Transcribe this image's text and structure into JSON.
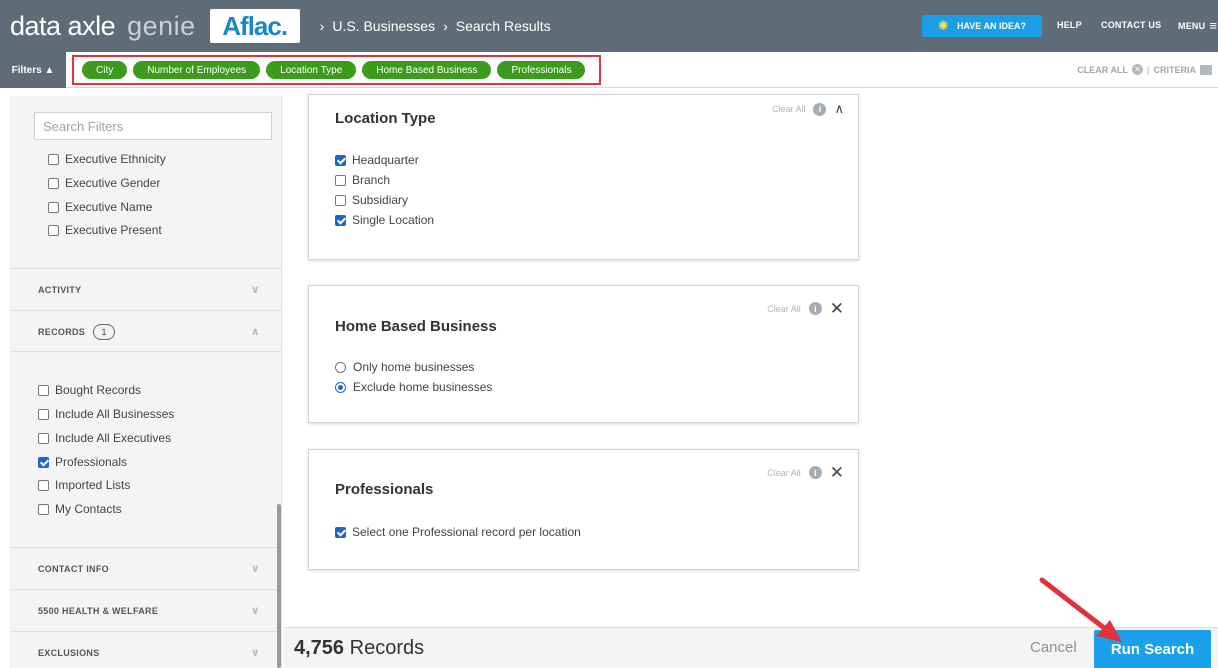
{
  "header": {
    "brand_name": "data axle",
    "brand_product": "genie",
    "client_logo_text": "Aflac.",
    "breadcrumb": [
      "U.S. Businesses",
      "Search Results"
    ],
    "breadcrumb_separator": "›",
    "idea_button": "HAVE AN IDEA?",
    "help": "HELP",
    "contact": "CONTACT US",
    "menu": "MENU"
  },
  "filter_bar": {
    "toggle_label": "Filters ▲",
    "chips": [
      "City",
      "Number of Employees",
      "Location Type",
      "Home Based Business",
      "Professionals"
    ],
    "clear_all": "CLEAR ALL",
    "criteria": "CRITERIA",
    "chip_color": "#3c9a1c",
    "highlight_color": "#e0323a"
  },
  "sidebar": {
    "search_placeholder": "Search Filters",
    "executive_items": [
      {
        "label": "Executive Ethnicity",
        "checked": false
      },
      {
        "label": "Executive Gender",
        "checked": false
      },
      {
        "label": "Executive Name",
        "checked": false
      },
      {
        "label": "Executive Present",
        "checked": false
      }
    ],
    "sections": {
      "activity": "ACTIVITY",
      "records": "RECORDS",
      "records_count": "1",
      "contact_info": "CONTACT INFO",
      "health_welfare": "5500 HEALTH & WELFARE",
      "exclusions": "EXCLUSIONS"
    },
    "record_items": [
      {
        "label": "Bought Records",
        "checked": false
      },
      {
        "label": "Include All Businesses",
        "checked": false
      },
      {
        "label": "Include All Executives",
        "checked": false
      },
      {
        "label": "Professionals",
        "checked": true
      },
      {
        "label": "Imported Lists",
        "checked": false
      },
      {
        "label": "My Contacts",
        "checked": false
      }
    ]
  },
  "cards": {
    "location_type": {
      "title": "Location Type",
      "clear_all": "Clear All",
      "options": [
        {
          "label": "Headquarter",
          "checked": true
        },
        {
          "label": "Branch",
          "checked": false
        },
        {
          "label": "Subsidiary",
          "checked": false
        },
        {
          "label": "Single Location",
          "checked": true
        }
      ]
    },
    "home_based": {
      "title": "Home Based Business",
      "clear_all": "Clear All",
      "options": [
        {
          "label": "Only home businesses",
          "selected": false
        },
        {
          "label": "Exclude home businesses",
          "selected": true
        }
      ]
    },
    "professionals": {
      "title": "Professionals",
      "clear_all": "Clear All",
      "options": [
        {
          "label": "Select one Professional record per location",
          "checked": true
        }
      ]
    }
  },
  "footer": {
    "records_number": "4,756",
    "records_label": "Records",
    "cancel": "Cancel",
    "run_search": "Run Search"
  },
  "icons": {
    "info": "i",
    "close": "✕",
    "chevron_up": "∧",
    "chevron_down": "∨",
    "bulb": "💡"
  },
  "colors": {
    "header_bg": "#5f6b77",
    "accent_blue": "#1ba1ec",
    "check_blue": "#1e66c8",
    "annotation_red": "#e0323a"
  }
}
